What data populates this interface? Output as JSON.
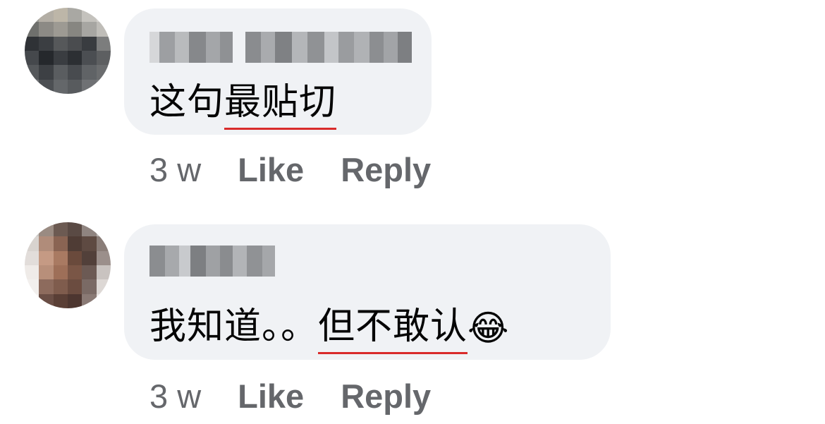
{
  "comments": [
    {
      "text_before": "这句",
      "text_underlined": "最贴切",
      "text_after": "",
      "emoji": "",
      "time": "3 w",
      "like_label": "Like",
      "reply_label": "Reply"
    },
    {
      "text_before": "我知道。。",
      "text_underlined": "但不敢认",
      "text_after": "",
      "emoji": "😂",
      "time": "3 w",
      "like_label": "Like",
      "reply_label": "Reply"
    }
  ],
  "colors": {
    "bubble": "#f0f2f5",
    "underline": "#d92b2b",
    "meta_text": "#65676b",
    "body_text": "#050505"
  }
}
